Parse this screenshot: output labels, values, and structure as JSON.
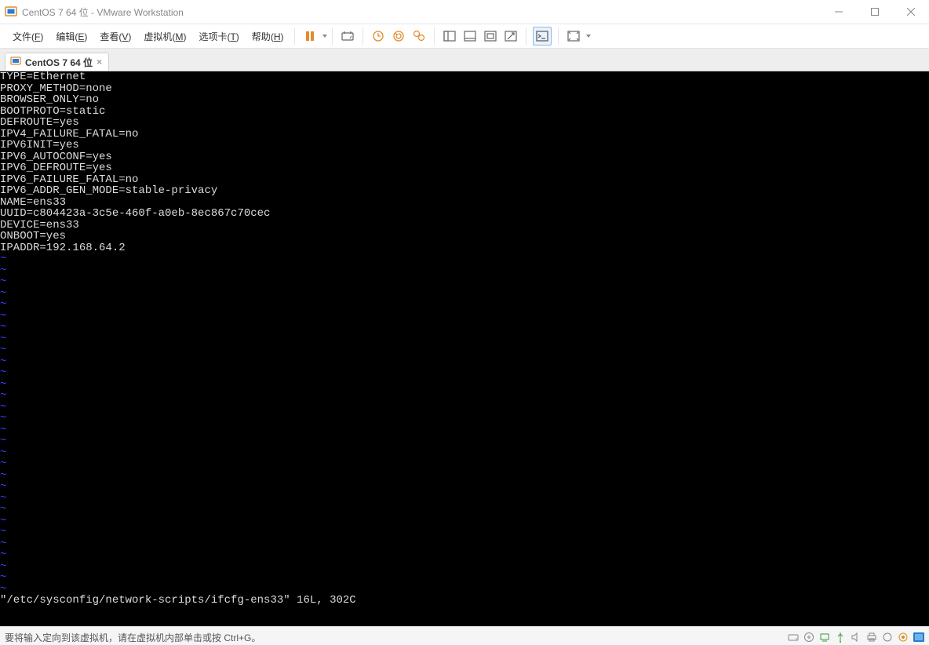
{
  "window": {
    "title": "CentOS 7 64 位 - VMware Workstation"
  },
  "menus": {
    "file": {
      "label": "文件",
      "key": "F"
    },
    "edit": {
      "label": "编辑",
      "key": "E"
    },
    "view": {
      "label": "查看",
      "key": "V"
    },
    "vm": {
      "label": "虚拟机",
      "key": "M"
    },
    "tabs": {
      "label": "选项卡",
      "key": "T"
    },
    "help": {
      "label": "帮助",
      "key": "H"
    }
  },
  "icons": {
    "pause": "pause",
    "printer": "printer",
    "snapshot_take": "snapshot-take",
    "snapshot_revert": "snapshot-revert",
    "snapshot_manage": "snapshot-manage",
    "view_single": "single-window",
    "view_dual": "dual-window",
    "view_full": "fullscreen-view",
    "view_unity": "unity",
    "console": "console",
    "expand": "fullscreen"
  },
  "tab": {
    "label": "CentOS 7 64 位"
  },
  "terminal": {
    "lines": [
      "TYPE=Ethernet",
      "PROXY_METHOD=none",
      "BROWSER_ONLY=no",
      "BOOTPROTO=static",
      "DEFROUTE=yes",
      "IPV4_FAILURE_FATAL=no",
      "IPV6INIT=yes",
      "IPV6_AUTOCONF=yes",
      "IPV6_DEFROUTE=yes",
      "IPV6_FAILURE_FATAL=no",
      "IPV6_ADDR_GEN_MODE=stable-privacy",
      "NAME=ens33",
      "UUID=c804423a-3c5e-460f-a0eb-8ec867c70cec",
      "DEVICE=ens33",
      "ONBOOT=yes",
      "IPADDR=192.168.64.2"
    ],
    "tilde_rows": 30,
    "status_line": "\"/etc/sysconfig/network-scripts/ifcfg-ens33\" 16L, 302C"
  },
  "statusbar": {
    "hint": "要将输入定向到该虚拟机，请在虚拟机内部单击或按 Ctrl+G。"
  }
}
